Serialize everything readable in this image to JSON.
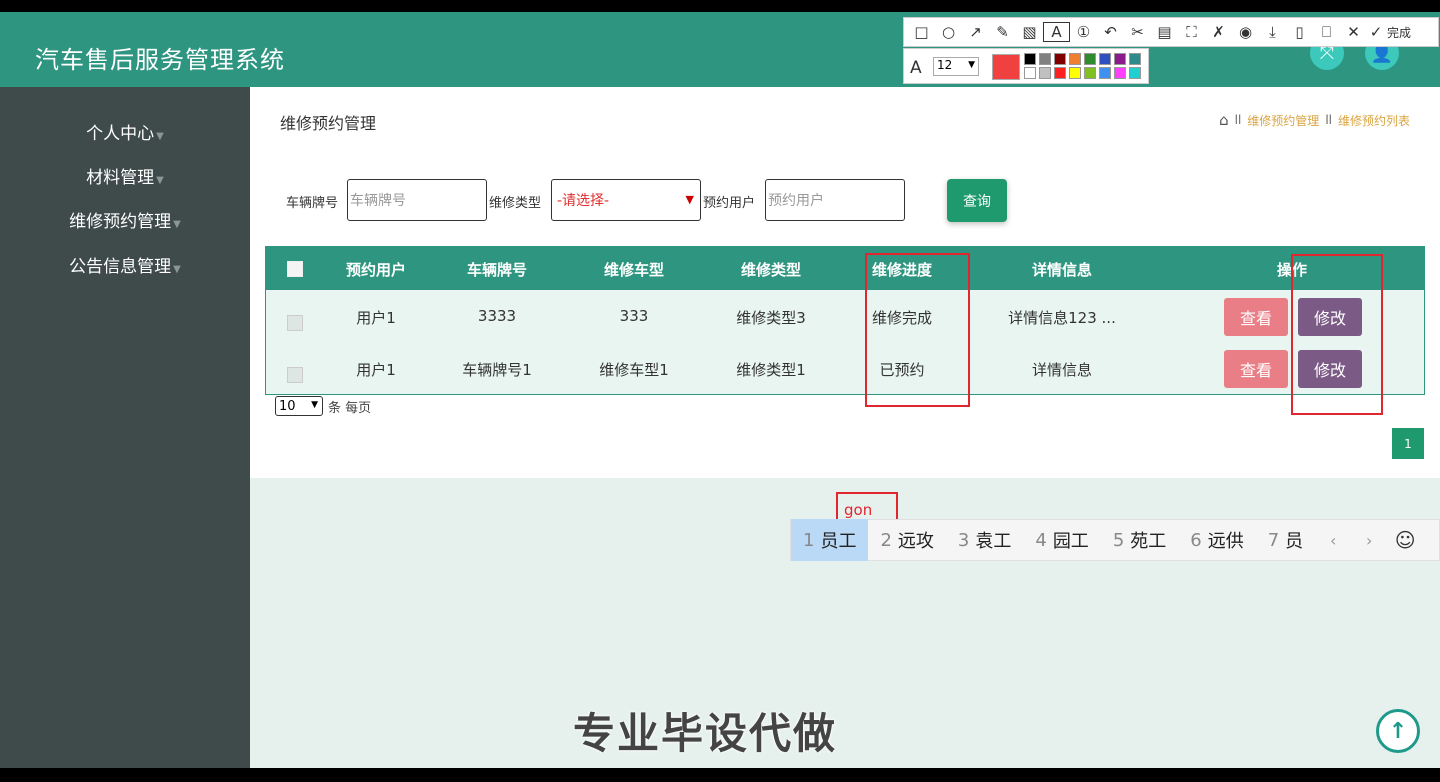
{
  "app": {
    "title": "汽车售后服务管理系统"
  },
  "header_icons": [
    {
      "name": "expand-icon",
      "glyph": "⤧"
    },
    {
      "name": "user-icon",
      "glyph": "👤"
    }
  ],
  "sidebar": {
    "items": [
      {
        "label": "个人中心"
      },
      {
        "label": "材料管理"
      },
      {
        "label": "维修预约管理"
      },
      {
        "label": "公告信息管理"
      }
    ]
  },
  "page": {
    "title": "维修预约管理",
    "breadcrumb": [
      "维修预约管理",
      "维修预约列表"
    ]
  },
  "filters": {
    "plate_label": "车辆牌号",
    "plate_placeholder": "车辆牌号",
    "type_label": "维修类型",
    "type_selected": "-请选择-",
    "user_label": "预约用户",
    "user_placeholder": "预约用户",
    "query_label": "查询"
  },
  "table": {
    "headers": [
      "预约用户",
      "车辆牌号",
      "维修车型",
      "维修类型",
      "维修进度",
      "详情信息",
      "操作"
    ],
    "rows": [
      {
        "user": "用户1",
        "plate": "3333",
        "model": "333",
        "type": "维修类型3",
        "progress": "维修完成",
        "detail": "详情信息123 ...",
        "view": "查看",
        "edit": "修改"
      },
      {
        "user": "用户1",
        "plate": "车辆牌号1",
        "model": "维修车型1",
        "type": "维修类型1",
        "progress": "已预约",
        "detail": "详情信息",
        "view": "查看",
        "edit": "修改"
      }
    ]
  },
  "pagination": {
    "per_page": "10",
    "per_page_label": "条 每页",
    "current_page": "1"
  },
  "ime": {
    "input": "gon",
    "candidates": [
      {
        "num": "1",
        "text": "员工"
      },
      {
        "num": "2",
        "text": "远攻"
      },
      {
        "num": "3",
        "text": "袁工"
      },
      {
        "num": "4",
        "text": "园工"
      },
      {
        "num": "5",
        "text": "苑工"
      },
      {
        "num": "6",
        "text": "远供"
      },
      {
        "num": "7",
        "text": "员"
      }
    ],
    "prev": "‹",
    "next": "›",
    "emoji": "☺"
  },
  "watermark": "专业毕设代做",
  "snip_toolbar": {
    "icons": [
      {
        "name": "rect-icon",
        "glyph": "□"
      },
      {
        "name": "ellipse-icon",
        "glyph": "○"
      },
      {
        "name": "arrow-icon",
        "glyph": "↗"
      },
      {
        "name": "pen-icon",
        "glyph": "✎"
      },
      {
        "name": "mosaic-icon",
        "glyph": "▧"
      },
      {
        "name": "text-icon",
        "glyph": "A"
      },
      {
        "name": "number-icon",
        "glyph": "①"
      },
      {
        "name": "undo-icon",
        "glyph": "↶"
      },
      {
        "name": "cut-icon",
        "glyph": "✂"
      },
      {
        "name": "ocr-icon",
        "glyph": "▤"
      },
      {
        "name": "scan-icon",
        "glyph": "⛶"
      },
      {
        "name": "pin-icon",
        "glyph": "✗"
      },
      {
        "name": "record-icon",
        "glyph": "◉"
      },
      {
        "name": "download-icon",
        "glyph": "⤓"
      },
      {
        "name": "phone-icon",
        "glyph": "▯"
      },
      {
        "name": "bookmark-icon",
        "glyph": "⎕"
      },
      {
        "name": "close-icon",
        "glyph": "✕"
      }
    ],
    "done_label": "完成",
    "font_size": "12",
    "current_color": "#f04040",
    "swatches": [
      "#000000",
      "#808080",
      "#800000",
      "#f08030",
      "#2e8b2e",
      "#3050c0",
      "#8b1a8b",
      "#2e8b8b",
      "#ffffff",
      "#c0c0c0",
      "#ff2020",
      "#ffff00",
      "#80c020",
      "#4090f0",
      "#ff40ff",
      "#20d0d0"
    ]
  }
}
